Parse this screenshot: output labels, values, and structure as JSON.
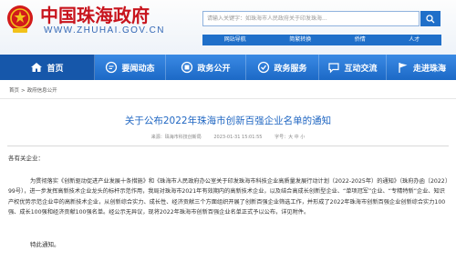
{
  "header": {
    "logo_title": "中国珠海政府",
    "logo_url": "WWW.ZHUHAI.GOV.CN",
    "search_placeholder": "请输入关键字：如珠海市人民政府关于印发珠海...",
    "quick_links": [
      "网站导航",
      "简繁转换",
      "侨情",
      "人才"
    ]
  },
  "nav": {
    "items": [
      {
        "label": "首页",
        "icon": "home-icon"
      },
      {
        "label": "要闻动态",
        "icon": "news-icon"
      },
      {
        "label": "政务公开",
        "icon": "open-gov-icon"
      },
      {
        "label": "政务服务",
        "icon": "service-icon"
      },
      {
        "label": "互动交流",
        "icon": "chat-icon"
      },
      {
        "label": "走进珠海",
        "icon": "flag-icon"
      }
    ]
  },
  "breadcrumb": [
    "首页",
    "政府信息公开"
  ],
  "article": {
    "title": "关于公布2022年珠海市创新百强企业名单的通知",
    "meta": {
      "source": "来源：珠海市科技创新局",
      "date": "2023-01-31 15:01:55",
      "font_size": "字号：大  中  小"
    },
    "salutation": "各有关企业：",
    "paragraph": "为贯彻落实《创新驱动促进产业发展十条措施》和《珠海市人民政府办公室关于印发珠海市科技企业高质量发展行动计划（2022-2025年）的通知》（珠府办函〔2022〕99号），进一步发挥高新技术企业龙头的标杆示范作用，我局对珠海市2021年有效期内的高新技术企业，以及结合高成长创新型企业、“单项冠军”企业、“专精特新”企业、知识产权优势示范企业中的高新技术企业，从创新综合实力、成长性、经济贡献三个方面组织开展了创新百强企业筛选工作，并形成了2022年珠海市创新百强企业创新综合实力100强、成长100强和经济贡献100强名单。经公示无异议，现将2022年珠海市创新百强企业名单正式予以公布，详见附件。",
    "closing": "特此通知。"
  },
  "colors": {
    "brand_red": "#c8141d",
    "nav_blue": "#1f6fc9",
    "title_blue": "#1f66c2"
  }
}
